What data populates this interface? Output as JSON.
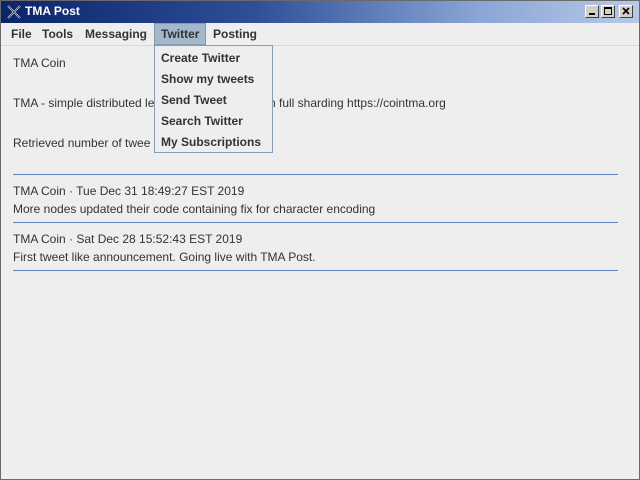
{
  "window": {
    "title": "TMA Post"
  },
  "menubar": {
    "items": [
      "File",
      "Tools",
      "Messaging",
      "Twitter",
      "Posting"
    ],
    "active": "Twitter"
  },
  "twitter_menu": {
    "items": [
      "Create Twitter",
      "Show my tweets",
      "Send Tweet",
      "Search Twitter",
      "My Subscriptions"
    ]
  },
  "main": {
    "account_name": "TMA Coin",
    "description_left": "TMA - simple distributed le",
    "description_right": "n full sharding https://cointma.org",
    "retrieved_left": "Retrieved number of twee",
    "tweets": [
      {
        "header": "TMA Coin · Tue Dec 31 18:49:27 EST 2019",
        "body": "More nodes updated their code containing fix for character encoding"
      },
      {
        "header": "TMA Coin · Sat Dec 28 15:52:43 EST 2019",
        "body": "First tweet like announcement. Going live with TMA Post."
      }
    ]
  },
  "colors": {
    "title_gradient_start": "#0a246a",
    "menu_active_bg": "#a3b8cc",
    "separator": "#6382bf",
    "background": "#eeeeee"
  },
  "icons": {
    "app": "tma-x-icon",
    "minimize": "minimize-icon",
    "maximize": "maximize-icon",
    "close": "close-icon"
  }
}
